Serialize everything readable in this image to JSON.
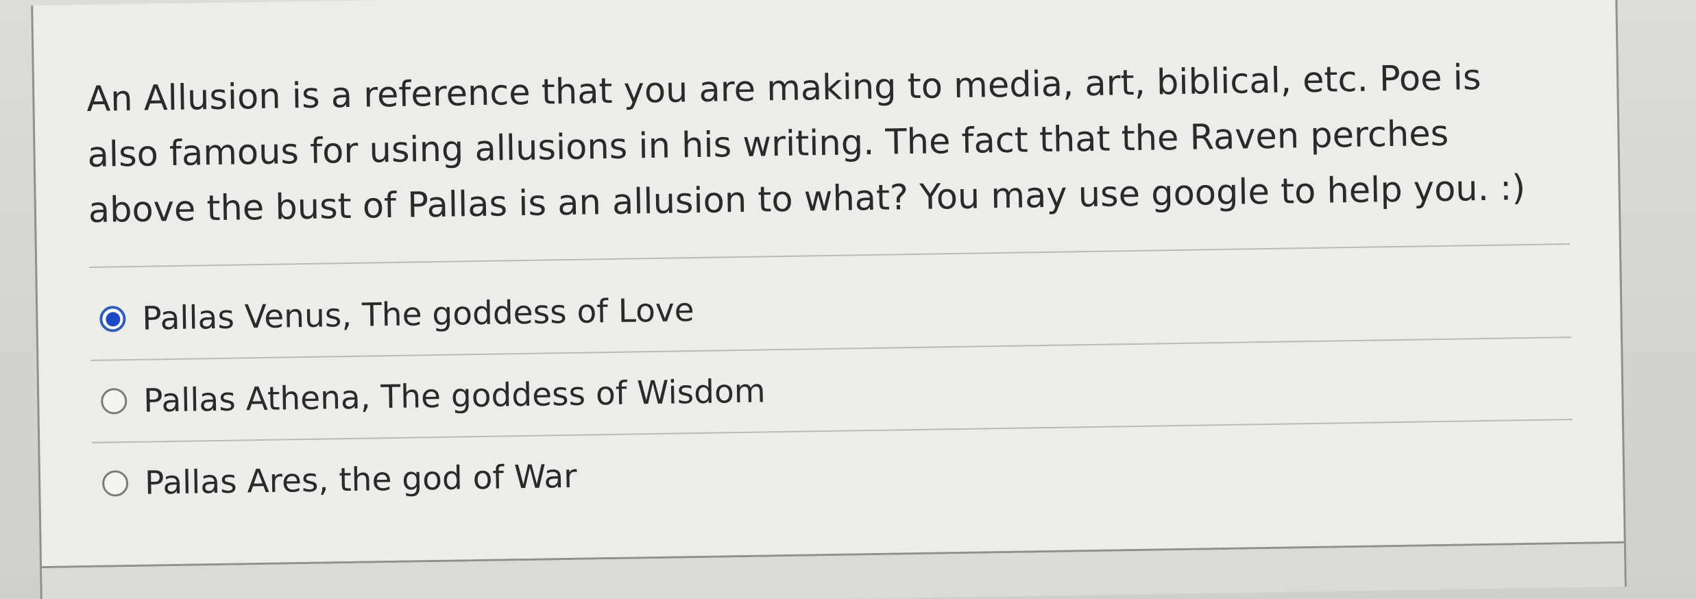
{
  "quiz": {
    "question": "An Allusion is a reference that you are making to media, art, biblical, etc. Poe is also famous for using allusions in his writing. The fact that the Raven perches above the bust of Pallas is an allusion to what? You may use google to help you. :)",
    "options": [
      {
        "label": "Pallas Venus, The goddess of Love",
        "selected": true
      },
      {
        "label": "Pallas Athena, The goddess of Wisdom",
        "selected": false
      },
      {
        "label": "Pallas Ares, the god of War",
        "selected": false
      }
    ]
  },
  "colors": {
    "selected_radio": "#1f49c2",
    "text": "#2a2a2a",
    "card_background": "#ececea"
  }
}
